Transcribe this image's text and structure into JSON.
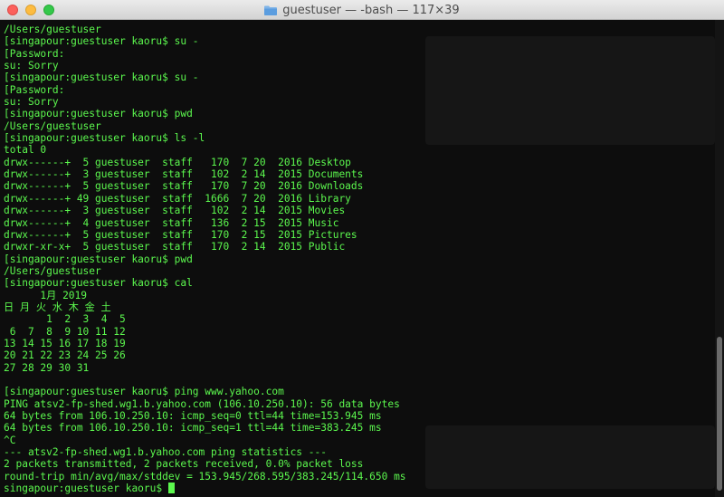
{
  "window": {
    "title": "guestuser — -bash — 117×39"
  },
  "terminal": {
    "lines": [
      "/Users/guestuser",
      "[singapour:guestuser kaoru$ su -",
      "[Password:",
      "su: Sorry",
      "[singapour:guestuser kaoru$ su -",
      "[Password:",
      "su: Sorry",
      "[singapour:guestuser kaoru$ pwd",
      "/Users/guestuser",
      "[singapour:guestuser kaoru$ ls -l",
      "total 0",
      "drwx------+  5 guestuser  staff   170  7 20  2016 Desktop",
      "drwx------+  3 guestuser  staff   102  2 14  2015 Documents",
      "drwx------+  5 guestuser  staff   170  7 20  2016 Downloads",
      "drwx------+ 49 guestuser  staff  1666  7 20  2016 Library",
      "drwx------+  3 guestuser  staff   102  2 14  2015 Movies",
      "drwx------+  4 guestuser  staff   136  2 15  2015 Music",
      "drwx------+  5 guestuser  staff   170  2 15  2015 Pictures",
      "drwxr-xr-x+  5 guestuser  staff   170  2 14  2015 Public",
      "[singapour:guestuser kaoru$ pwd",
      "/Users/guestuser",
      "[singapour:guestuser kaoru$ cal",
      "      1月 2019",
      "日 月 火 水 木 金 土",
      "       1  2  3  4  5",
      " 6  7  8  9 10 11 12",
      "13 14 15 16 17 18 19",
      "20 21 22 23 24 25 26",
      "27 28 29 30 31",
      "",
      "[singapour:guestuser kaoru$ ping www.yahoo.com",
      "PING atsv2-fp-shed.wg1.b.yahoo.com (106.10.250.10): 56 data bytes",
      "64 bytes from 106.10.250.10: icmp_seq=0 ttl=44 time=153.945 ms",
      "64 bytes from 106.10.250.10: icmp_seq=1 ttl=44 time=383.245 ms",
      "^C",
      "--- atsv2-fp-shed.wg1.b.yahoo.com ping statistics ---",
      "2 packets transmitted, 2 packets received, 0.0% packet loss",
      "round-trip min/avg/max/stddev = 153.945/268.595/383.245/114.650 ms",
      "singapour:guestuser kaoru$ "
    ]
  },
  "colors": {
    "text": "#5cf84e",
    "background": "#0d0d0d"
  }
}
